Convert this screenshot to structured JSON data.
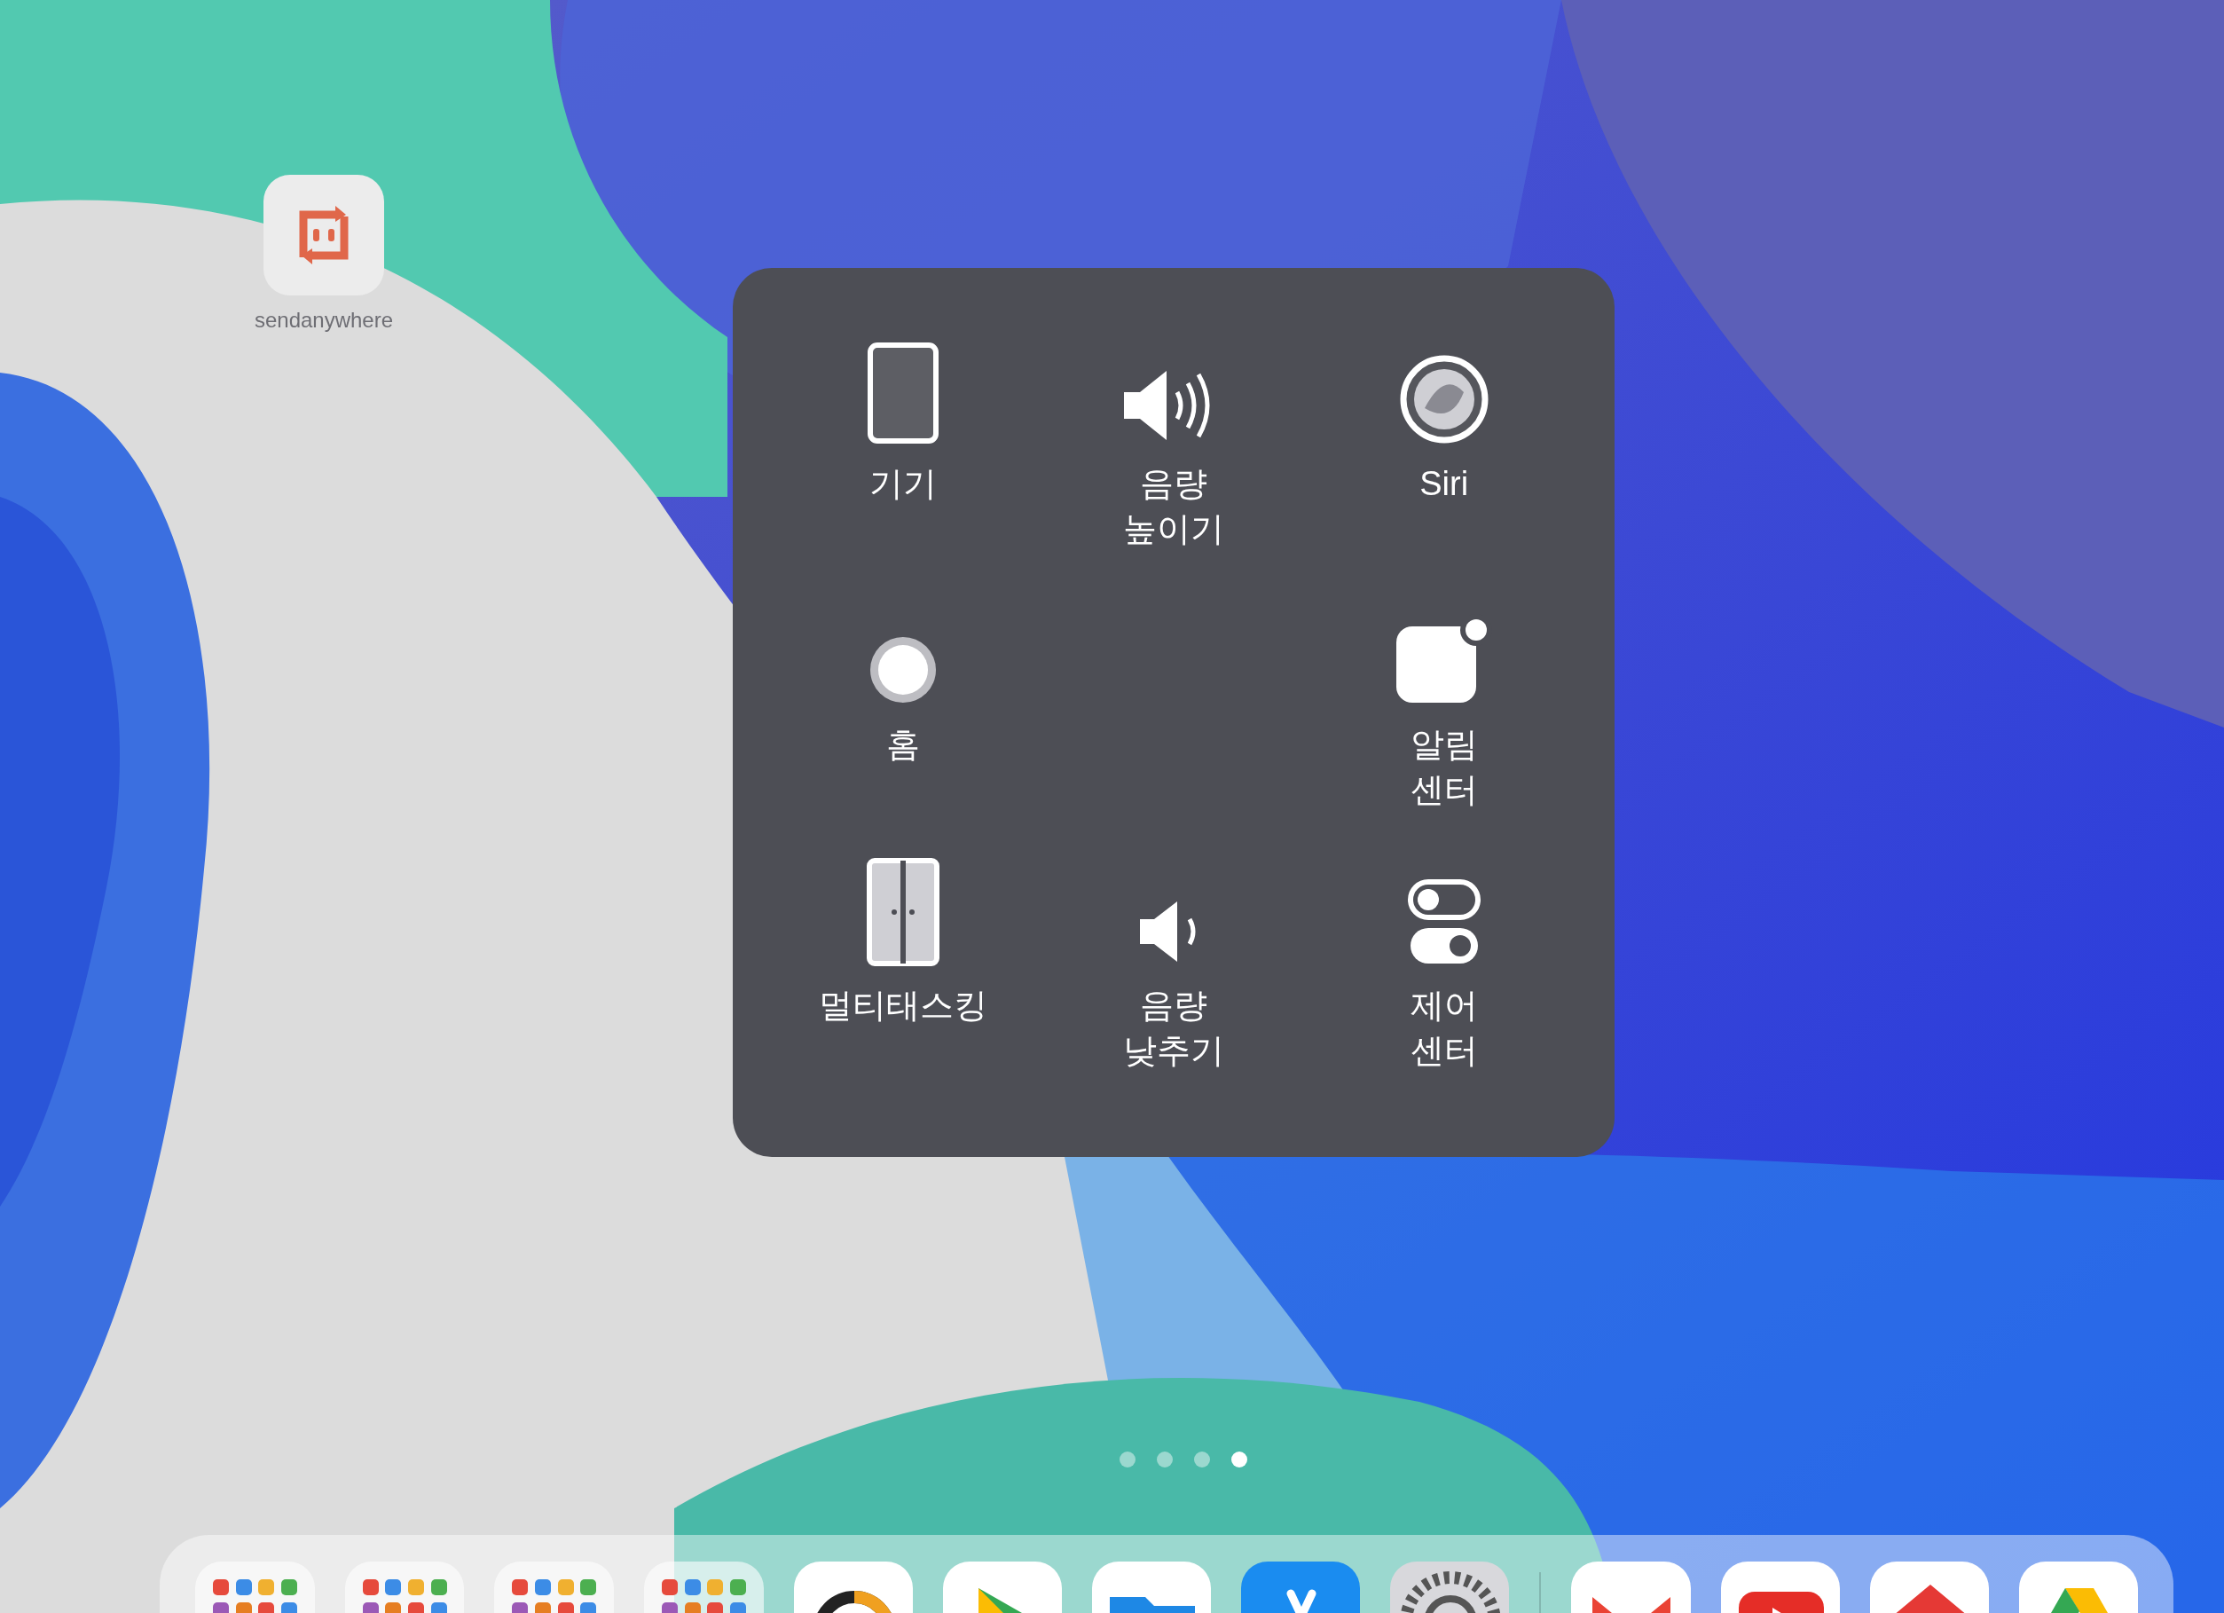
{
  "home_screen": {
    "app": {
      "label": "sendanywhere"
    },
    "page_dots": [
      {
        "selected": false
      },
      {
        "selected": false
      },
      {
        "selected": false
      },
      {
        "selected": true
      }
    ]
  },
  "assistive_menu": {
    "items": [
      {
        "kind": "device",
        "label": "기기"
      },
      {
        "kind": "volume-up",
        "label": "음량\n높이기"
      },
      {
        "kind": "siri",
        "label": "Siri"
      },
      {
        "kind": "home",
        "label": "홈"
      },
      {
        "kind": "empty"
      },
      {
        "kind": "notifications",
        "label": "알림\n센터"
      },
      {
        "kind": "multitasking",
        "label": "멀티태스킹"
      },
      {
        "kind": "volume-down",
        "label": "음량\n낮추기"
      },
      {
        "kind": "control",
        "label": "제어\n센터"
      }
    ]
  },
  "dock": {
    "items": [
      {
        "kind": "folder"
      },
      {
        "kind": "folder"
      },
      {
        "kind": "folder"
      },
      {
        "kind": "folder"
      },
      {
        "kind": "chart"
      },
      {
        "kind": "play"
      },
      {
        "kind": "files"
      },
      {
        "kind": "store"
      },
      {
        "kind": "settings"
      },
      {
        "kind": "divider"
      },
      {
        "kind": "mail"
      },
      {
        "kind": "video"
      },
      {
        "kind": "house"
      },
      {
        "kind": "drive"
      }
    ]
  }
}
